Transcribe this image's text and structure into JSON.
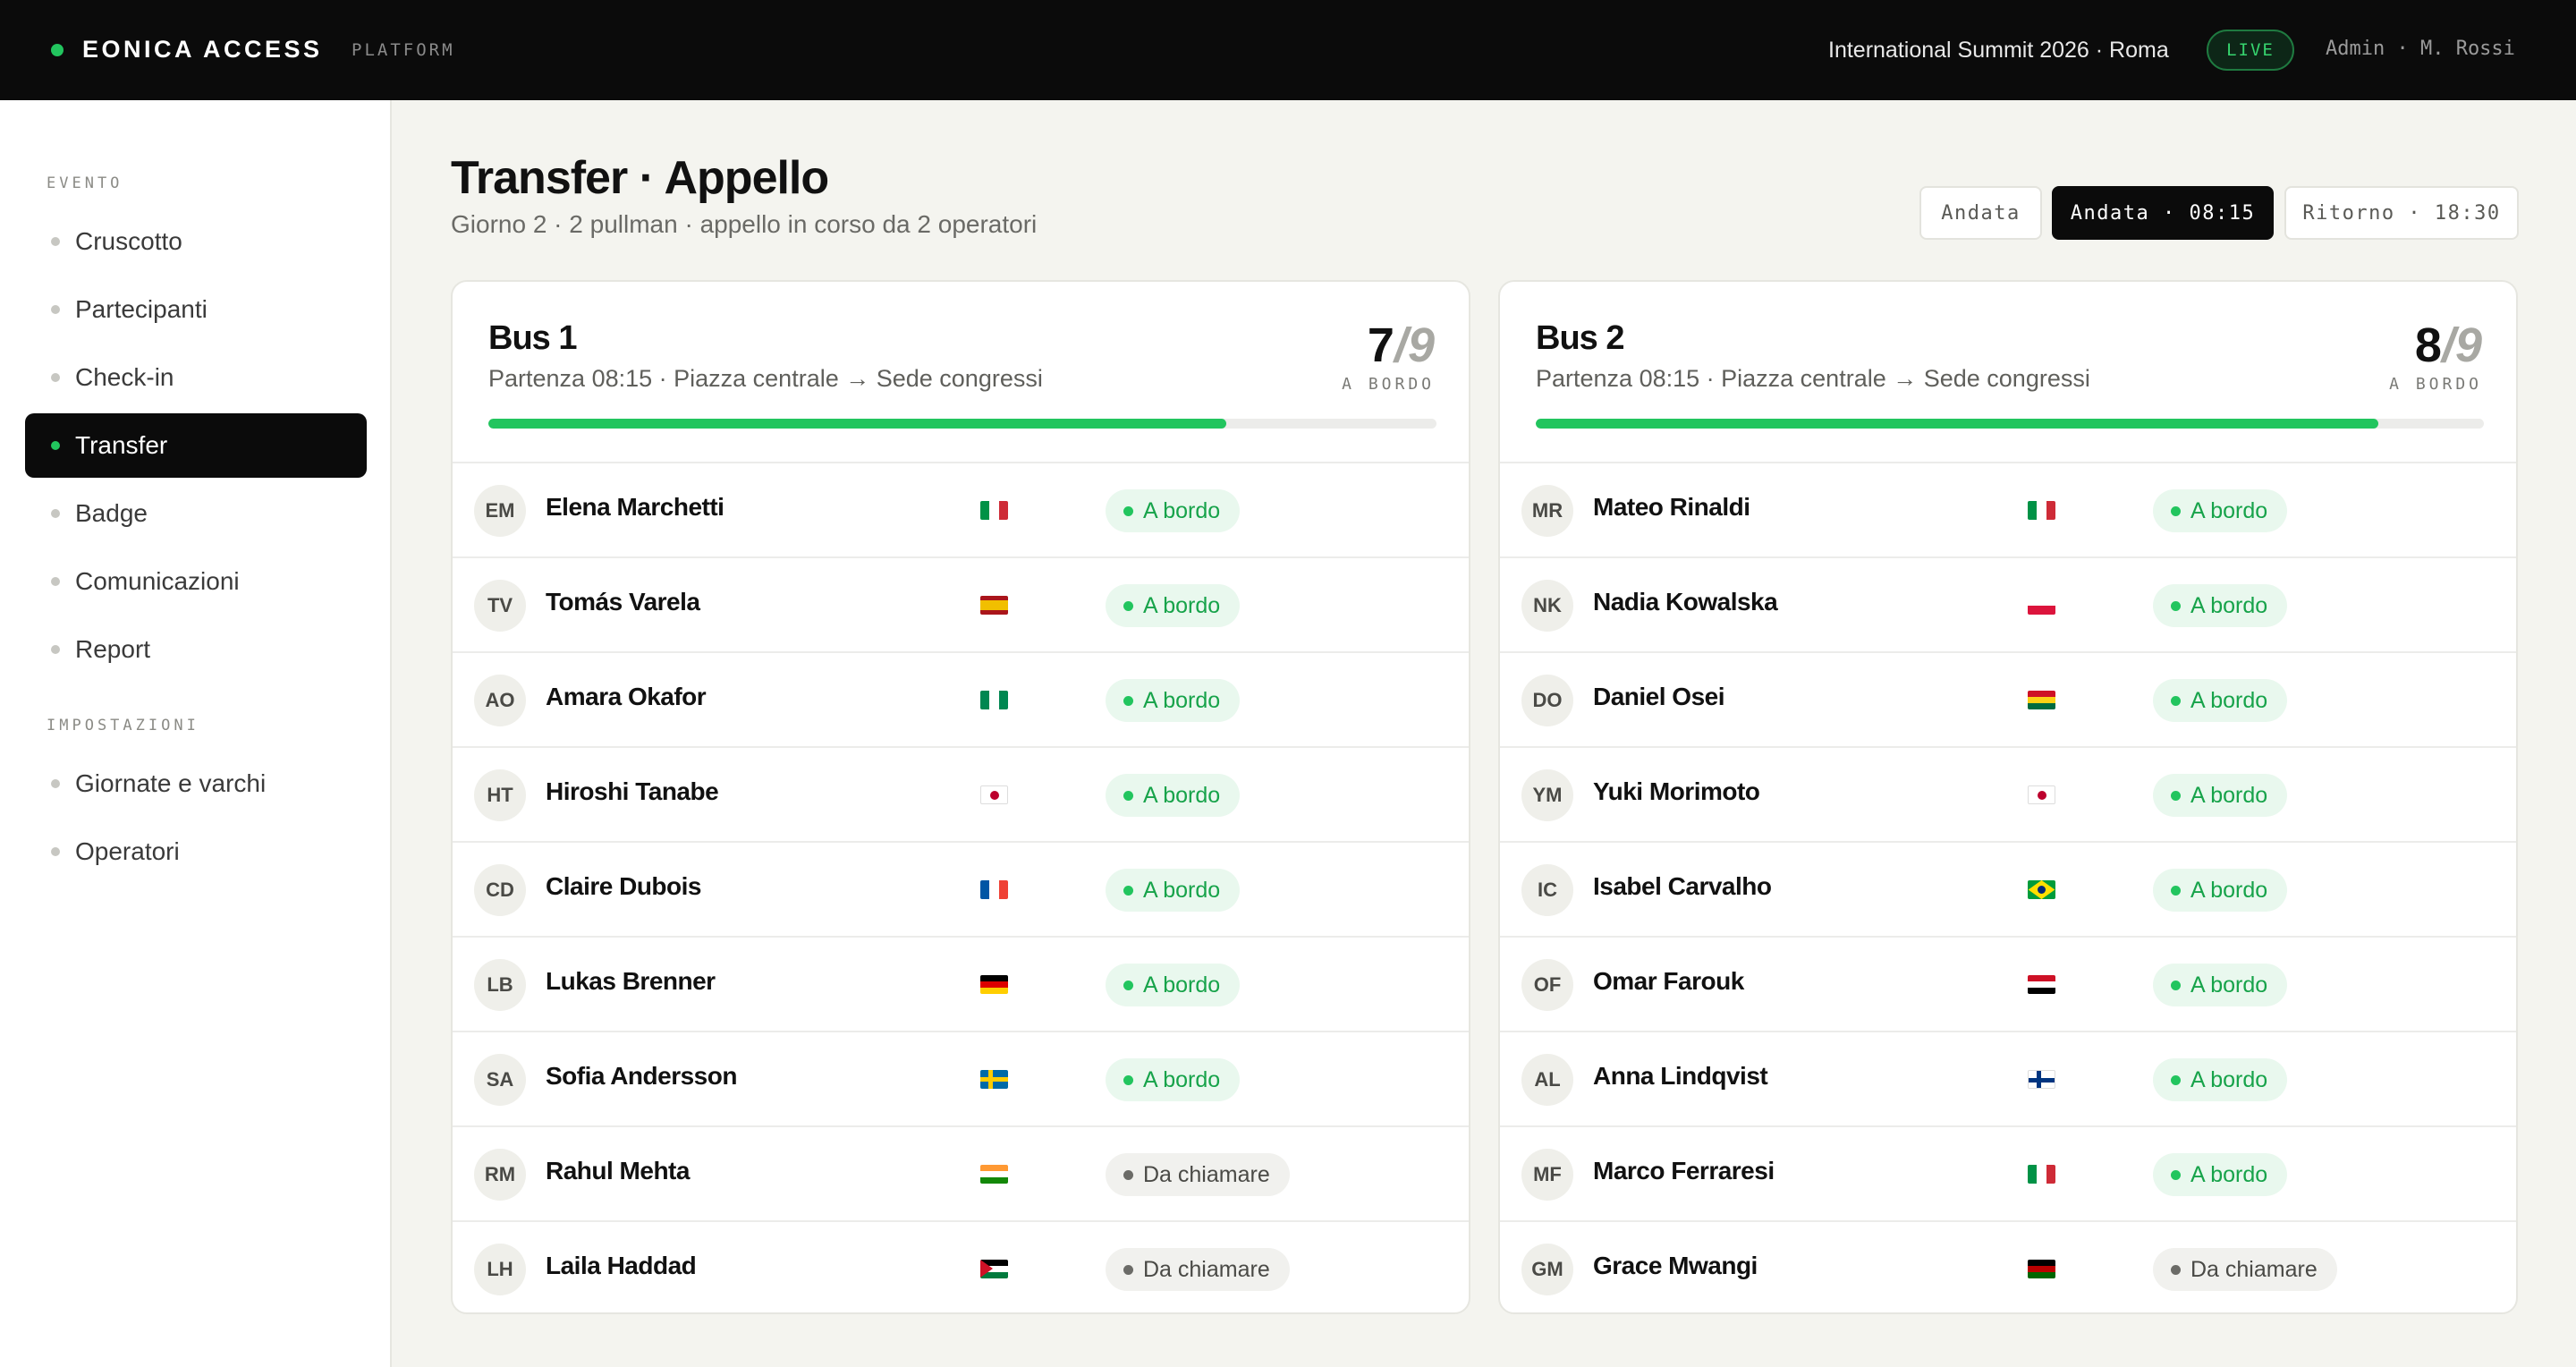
{
  "header": {
    "brand": "EONICA ACCESS",
    "brand_sub": "PLATFORM",
    "event": "International Summit 2026 · Roma",
    "live": "LIVE",
    "admin": "Admin · M. Rossi"
  },
  "sidebar": {
    "section_evento": "EVENTO",
    "section_impostazioni": "IMPOSTAZIONI",
    "items": [
      "Cruscotto",
      "Partecipanti",
      "Check-in",
      "Transfer",
      "Badge",
      "Comunicazioni",
      "Report"
    ],
    "settings_items": [
      "Giornate e varchi",
      "Operatori"
    ],
    "active": "Transfer"
  },
  "page": {
    "title": "Transfer · Appello",
    "subtitle": "Giorno 2 · 2 pullman · appello in corso da 2 operatori"
  },
  "segments": [
    "Andata",
    "Andata · 08:15",
    "Ritorno · 18:30"
  ],
  "colors": {
    "accent": "#22c55e",
    "dark": "#0b0b0b",
    "ok_text": "#17a34a"
  },
  "buses": [
    {
      "title": "Bus 1",
      "subtitle": "Partenza 08:15 · Piazza centrale → Sede congressi",
      "onboard": "7",
      "total": "/9",
      "onboard_label": "A BORDO",
      "progress": 0.778,
      "passengers": [
        {
          "initials": "EM",
          "name": "Elena Marchetti",
          "flag": "italy-flag",
          "status": "A bordo",
          "ok": true
        },
        {
          "initials": "TV",
          "name": "Tomás Varela",
          "flag": "spain-flag",
          "status": "A bordo",
          "ok": true
        },
        {
          "initials": "AO",
          "name": "Amara Okafor",
          "flag": "nigeria-flag",
          "status": "A bordo",
          "ok": true
        },
        {
          "initials": "HT",
          "name": "Hiroshi Tanabe",
          "flag": "japan-flag",
          "status": "A bordo",
          "ok": true
        },
        {
          "initials": "CD",
          "name": "Claire Dubois",
          "flag": "france-flag",
          "status": "A bordo",
          "ok": true
        },
        {
          "initials": "LB",
          "name": "Lukas Brenner",
          "flag": "germany-flag",
          "status": "A bordo",
          "ok": true
        },
        {
          "initials": "SA",
          "name": "Sofia Andersson",
          "flag": "sweden-flag",
          "status": "A bordo",
          "ok": true
        },
        {
          "initials": "RM",
          "name": "Rahul Mehta",
          "flag": "india-flag",
          "status": "Da chiamare",
          "ok": false
        },
        {
          "initials": "LH",
          "name": "Laila Haddad",
          "flag": "jordan-flag",
          "status": "Da chiamare",
          "ok": false
        }
      ]
    },
    {
      "title": "Bus 2",
      "subtitle": "Partenza 08:15 · Piazza centrale → Sede congressi",
      "onboard": "8",
      "total": "/9",
      "onboard_label": "A BORDO",
      "progress": 0.889,
      "passengers": [
        {
          "initials": "MR",
          "name": "Mateo Rinaldi",
          "flag": "italy-flag",
          "status": "A bordo",
          "ok": true
        },
        {
          "initials": "NK",
          "name": "Nadia Kowalska",
          "flag": "poland-flag",
          "status": "A bordo",
          "ok": true
        },
        {
          "initials": "DO",
          "name": "Daniel Osei",
          "flag": "ghana-flag",
          "status": "A bordo",
          "ok": true
        },
        {
          "initials": "YM",
          "name": "Yuki Morimoto",
          "flag": "japan-flag",
          "status": "A bordo",
          "ok": true
        },
        {
          "initials": "IC",
          "name": "Isabel Carvalho",
          "flag": "brazil-flag",
          "status": "A bordo",
          "ok": true
        },
        {
          "initials": "OF",
          "name": "Omar Farouk",
          "flag": "egypt-flag",
          "status": "A bordo",
          "ok": true
        },
        {
          "initials": "AL",
          "name": "Anna Lindqvist",
          "flag": "finland-flag",
          "status": "A bordo",
          "ok": true
        },
        {
          "initials": "MF",
          "name": "Marco Ferraresi",
          "flag": "italy-flag",
          "status": "A bordo",
          "ok": true
        },
        {
          "initials": "GM",
          "name": "Grace Mwangi",
          "flag": "kenya-flag",
          "status": "Da chiamare",
          "ok": false
        }
      ]
    }
  ]
}
